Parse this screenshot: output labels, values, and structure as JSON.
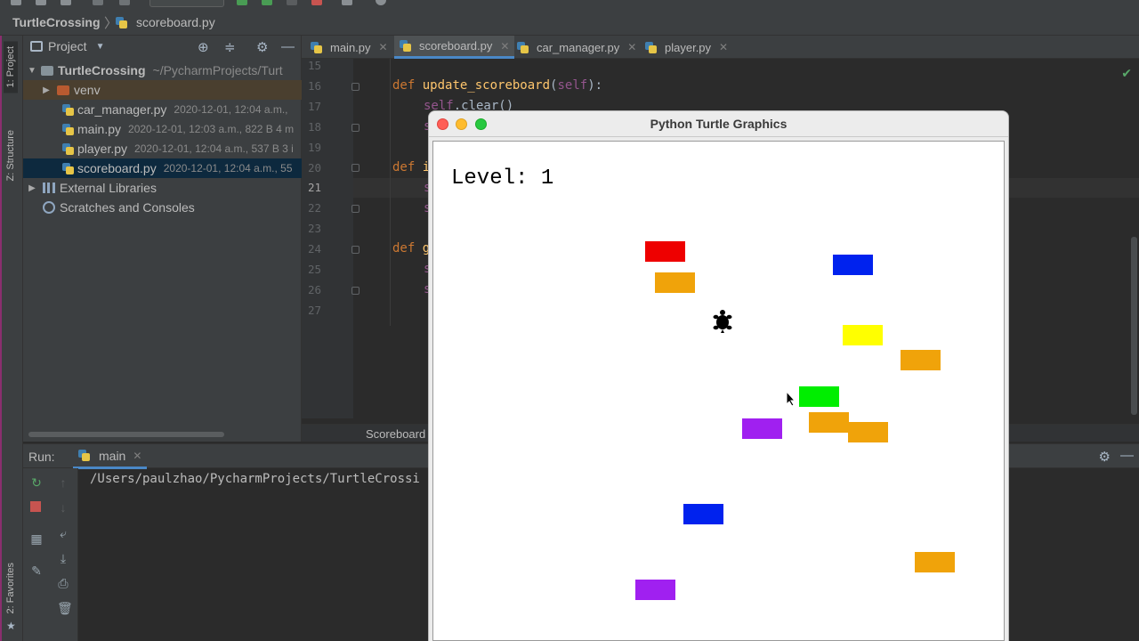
{
  "breadcrumb": {
    "project": "TurtleCrossing",
    "separator": "〉",
    "file": "scoreboard.py"
  },
  "left_strip": {
    "project_tab": "1: Project",
    "structure_tab": "Z: Structure",
    "favorites_tab": "2: Favorites"
  },
  "project_panel": {
    "title": "Project",
    "tree": {
      "root_name": "TurtleCrossing",
      "root_path": "~/PycharmProjects/Turt",
      "venv": "venv",
      "files": [
        {
          "name": "car_manager.py",
          "meta": "2020-12-01, 12:04 a.m.,"
        },
        {
          "name": "main.py",
          "meta": "2020-12-01, 12:03 a.m., 822 B 4 m"
        },
        {
          "name": "player.py",
          "meta": "2020-12-01, 12:04 a.m., 537 B 3 i"
        },
        {
          "name": "scoreboard.py",
          "meta": "2020-12-01, 12:04 a.m., 55"
        }
      ],
      "external_libraries": "External Libraries",
      "scratches": "Scratches and Consoles"
    }
  },
  "editor": {
    "tabs": [
      {
        "label": "main.py"
      },
      {
        "label": "scoreboard.py"
      },
      {
        "label": "car_manager.py"
      },
      {
        "label": "player.py"
      }
    ],
    "line_numbers": [
      "15",
      "16",
      "17",
      "18",
      "19",
      "20",
      "21",
      "22",
      "23",
      "24",
      "25",
      "26",
      "27"
    ],
    "code": {
      "def_kw": "def",
      "l16_fn": "update_scoreboard",
      "l16_rest": "(",
      "l16_self": "self",
      "l16_end": "):",
      "l17_self": "self",
      "l17_rest": ".clear()",
      "l20_partial": "i",
      "l24_partial": "g",
      "s_partial": "s"
    },
    "breadcrumb": "Scoreboard"
  },
  "run_panel": {
    "label": "Run:",
    "tab": "main",
    "console": "/Users/paulzhao/PycharmProjects/TurtleCrossi"
  },
  "turtle_window": {
    "title": "Python Turtle Graphics",
    "level_text": "Level: 1",
    "cars": [
      {
        "color": "#ee0000"
      },
      {
        "color": "#f0a30a"
      },
      {
        "color": "#0022ee"
      },
      {
        "color": "#ffff00"
      },
      {
        "color": "#f0a30a"
      },
      {
        "color": "#00ee00"
      },
      {
        "color": "#f0a30a"
      },
      {
        "color": "#f0a30a"
      },
      {
        "color": "#a020f0"
      },
      {
        "color": "#0022ee"
      },
      {
        "color": "#f0a30a"
      },
      {
        "color": "#a020f0"
      }
    ]
  },
  "colors": {
    "ide_bg": "#2b2b2b",
    "panel_bg": "#3c3f41",
    "keyword": "#cc7832",
    "function": "#ffc66d",
    "self": "#94558d",
    "selection": "#0d293e",
    "tab_underline": "#4a88c7"
  }
}
